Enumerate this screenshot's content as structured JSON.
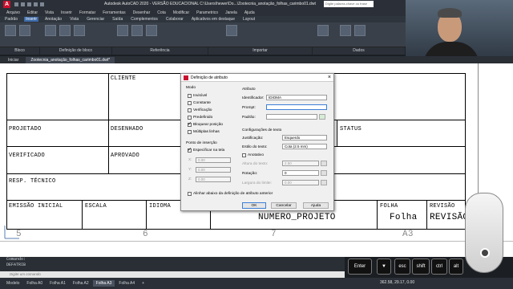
{
  "titlebar": {
    "title": "Autodesk AutoCAD 2020 - VERSÃO EDUCACIONAL   C:\\Users\\hewer\\Do...\\Zootecnia_anotação_folhas_carimbo01.dwt",
    "search_placeholder": "Digite palavra-chave ou frase"
  },
  "menubar": [
    "Arquivo",
    "Editar",
    "Vista",
    "Inserir",
    "Formatar",
    "Ferramentas",
    "Desenhar",
    "Cota",
    "Modificar",
    "Parametrico",
    "Janela",
    "Ajuda"
  ],
  "ribbon_tabs": [
    "Padrão",
    "Inserir",
    "Anotação",
    "Vista",
    "Gerenciar",
    "Saída",
    "Complementos",
    "Colaborar",
    "Aplicativos em destaque",
    "Layout"
  ],
  "ribbon_active": "Inserir",
  "ribbon_groups": [
    "Bloco",
    "Definição de bloco",
    "Referência",
    "Importar",
    "Dados"
  ],
  "doc_tabs": [
    "Iniciar",
    "Zootecnia_anotação_folhas_carimbo01.dwt*"
  ],
  "drawing": {
    "cliente": "CLIENTE",
    "projetado": "PROJETADO",
    "desenhado": "DESENHADO",
    "status": "STATUS",
    "verificado": "VERIFICADO",
    "aprovado": "APROVADO",
    "resp_tecnico": "RESP. TÉCNICO",
    "emissao_inicial": "EMISSÃO INICIAL",
    "escala": "ESCALA",
    "idioma": "IDIOMA",
    "folha": "FOLHA",
    "revisao": "REVISÃO",
    "folha_value": "Folha",
    "revisao_value": "REVISÃO",
    "numero_projeto": "NUMERO_PROJETO",
    "grid_5": "5",
    "grid_6": "6",
    "grid_7": "7",
    "grid_a3": "A3"
  },
  "dialog": {
    "title": "Definição de atributo",
    "modo_label": "Modo",
    "modes": [
      {
        "label": "Invisível",
        "checked": false
      },
      {
        "label": "Constante",
        "checked": false
      },
      {
        "label": "Verificação",
        "checked": false
      },
      {
        "label": "Predefinido",
        "checked": false
      },
      {
        "label": "Bloquear posição",
        "checked": true
      },
      {
        "label": "Múltiplas linhas",
        "checked": false
      }
    ],
    "atributo_label": "Atributo",
    "identificador_label": "Identificador:",
    "identificador_value": "IDIOMA",
    "prompt_label": "Prompt:",
    "prompt_value": "",
    "padrao_label": "Padrão:",
    "padrao_value": "",
    "ponto_label": "Ponto de inserção",
    "especificar_label": "Especificar na tela",
    "especificar_checked": true,
    "x_label": "X:",
    "x_value": "0.00",
    "y_label": "Y:",
    "y_value": "0.00",
    "z_label": "Z:",
    "z_value": "0.00",
    "config_label": "Configurações de texto",
    "justificacao_label": "Justificação:",
    "justificacao_value": "Esquerdo",
    "estilo_label": "Estilo do texto:",
    "estilo_value": "Cota (2.5 mm)",
    "anotativo_label": "Anotativo",
    "altura_label": "Altura do texto:",
    "altura_value": "2.50",
    "rotacao_label": "Rotação:",
    "rotacao_value": "0",
    "largura_label": "Largura do limite:",
    "largura_value": "0.00",
    "alinhar_label": "Alinhar abaixo da definição de atributo anterior",
    "ok_label": "OK",
    "cancel_label": "Cancelar",
    "help_label": "Ajuda"
  },
  "command": {
    "line1": "Comando:",
    "line2": "DEFATRIB",
    "input_placeholder": "Digite um comando"
  },
  "status_tabs": [
    "Modelo",
    "Folha A0",
    "Folha A1",
    "Folha A2",
    "Folha A3",
    "Folha A4",
    "+"
  ],
  "status_active": "Folha A3",
  "coords": "362.58, 29.17, 0.00",
  "keys": [
    "Enter",
    "▼",
    "esc",
    "shift",
    "ctrl",
    "alt"
  ]
}
